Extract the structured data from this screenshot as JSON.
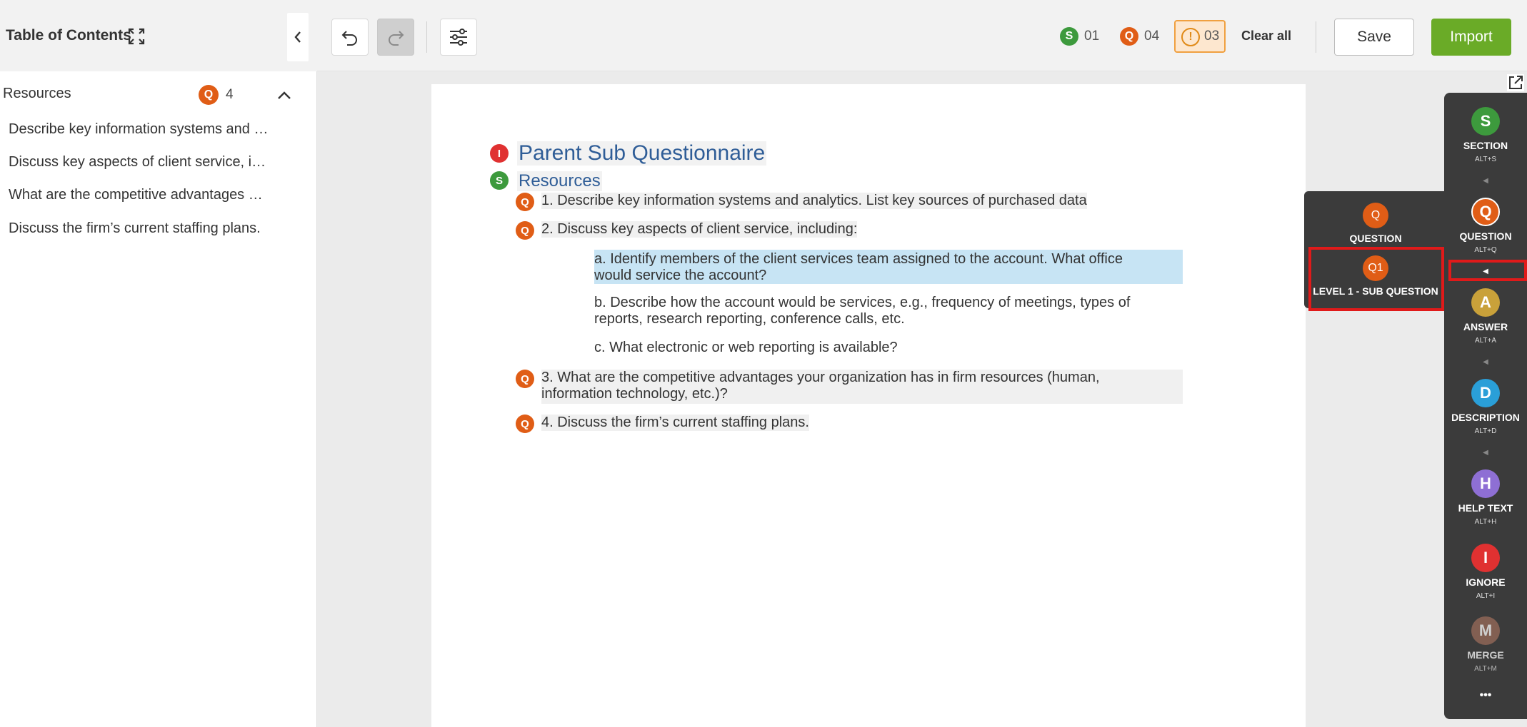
{
  "toc": {
    "title": "Table of Contents",
    "section": {
      "label": "Resources",
      "badge": "Q",
      "count": "4"
    },
    "items": [
      "Describe key information systems and …",
      "Discuss key aspects of client service, i…",
      "What are the competitive advantages …",
      "Discuss the firm’s current staffing plans."
    ]
  },
  "toolbar": {
    "section_badge": "S",
    "section_count": "01",
    "question_badge": "Q",
    "question_count": "04",
    "warning_badge": "!",
    "warning_count": "03",
    "clear_all": "Clear all",
    "save": "Save",
    "import": "Import"
  },
  "document": {
    "title_badge": "I",
    "title": "Parent Sub Questionnaire",
    "section_badge": "S",
    "section": "Resources",
    "q_badge": "Q",
    "q1": "1.  Describe key information systems and analytics. List key sources of purchased data",
    "q2": "2.  Discuss key aspects of client service, including:",
    "q2a_line1": "a.  Identify members of the client services team assigned to the account. What office",
    "q2a_line2": "would service the account?",
    "q2b_line1": "b.  Describe how the account would be services, e.g., frequency of meetings, types of",
    "q2b_line2": "reports, research reporting, conference calls, etc.",
    "q2c": "c.  What electronic or web reporting is available?",
    "q3_line1": "3.  What are the competitive advantages your organization has in firm resources (human,",
    "q3_line2": "information technology, etc.)?",
    "q4": "4.  Discuss the firm’s current staffing plans."
  },
  "flyout": {
    "question": {
      "badge": "Q",
      "label": "QUESTION"
    },
    "sub_question": {
      "badge": "Q1",
      "label": "LEVEL 1 - SUB QUESTION"
    }
  },
  "palette": {
    "items": [
      {
        "letter": "S",
        "label": "SECTION",
        "shortcut": "ALT+S",
        "color": "#3d9a3d"
      },
      {
        "letter": "Q",
        "label": "QUESTION",
        "shortcut": "ALT+Q",
        "color": "#e05d16"
      },
      {
        "letter": "A",
        "label": "ANSWER",
        "shortcut": "ALT+A",
        "color": "#c9a13a"
      },
      {
        "letter": "D",
        "label": "DESCRIPTION",
        "shortcut": "ALT+D",
        "color": "#2a9fd8"
      },
      {
        "letter": "H",
        "label": "HELP TEXT",
        "shortcut": "ALT+H",
        "color": "#8e6fd4"
      },
      {
        "letter": "I",
        "label": "IGNORE",
        "shortcut": "ALT+I",
        "color": "#e03131"
      },
      {
        "letter": "M",
        "label": "MERGE",
        "shortcut": "ALT+M",
        "color": "#9a6b5a"
      }
    ],
    "more": "•••"
  },
  "colors": {
    "section": "#3d9a3d",
    "question": "#e05d16",
    "ignore": "#e03131",
    "import": "#6aab27",
    "highlight": "#e01a1a"
  }
}
